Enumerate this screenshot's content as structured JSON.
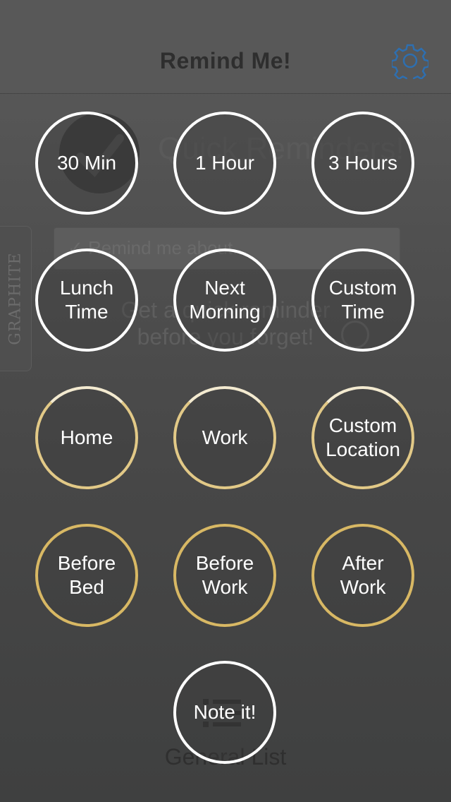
{
  "header": {
    "title": "Remind Me!"
  },
  "background": {
    "title": "Quick Reminders!",
    "input_placeholder": "Remind me about...",
    "hint_line1": "Get a quick reminder",
    "hint_line2": "before you forget!",
    "list_label": "General List"
  },
  "side_tab": {
    "label": "GRAPHITE"
  },
  "reminders": {
    "r0": {
      "line1": "30 Min"
    },
    "r1": {
      "line1": "1 Hour"
    },
    "r2": {
      "line1": "3 Hours"
    },
    "r3": {
      "line1": "Lunch",
      "line2": "Time"
    },
    "r4": {
      "line1": "Next",
      "line2": "Morning"
    },
    "r5": {
      "line1": "Custom",
      "line2": "Time"
    },
    "r6": {
      "line1": "Home"
    },
    "r7": {
      "line1": "Work"
    },
    "r8": {
      "line1": "Custom",
      "line2": "Location"
    },
    "r9": {
      "line1": "Before",
      "line2": "Bed"
    },
    "r10": {
      "line1": "Before",
      "line2": "Work"
    },
    "r11": {
      "line1": "After",
      "line2": "Work"
    },
    "r12": {
      "line1": "Note it!"
    }
  },
  "colors": {
    "white_ring": "#ffffff",
    "gold_ring": "#d8b864",
    "title_text": "#2e2e2e",
    "gear": "#2e6fb0"
  }
}
